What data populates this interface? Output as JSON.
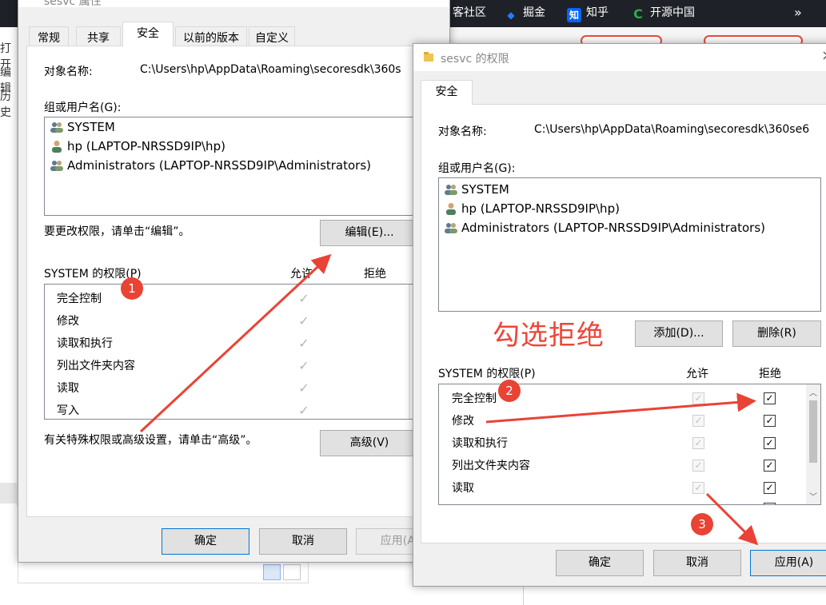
{
  "background": {
    "bookmarks": [
      {
        "label": "客社区",
        "icon": "",
        "color": "#1f2128"
      },
      {
        "label": "掘金",
        "icon": "juejin-icon",
        "color": "#1e80ff"
      },
      {
        "label": "知乎",
        "icon": "zhihu-icon",
        "glyph": "知",
        "color": "#0066ff"
      },
      {
        "label": "开源中国",
        "icon": "oschina-icon",
        "glyph": "C",
        "color": "#22b14c"
      }
    ],
    "more_glyph": "»",
    "left_texts": [
      "打开",
      "编辑",
      "历史"
    ]
  },
  "props_dialog": {
    "title": "sesvc 属性",
    "tabs": [
      "常规",
      "共享",
      "安全",
      "以前的版本",
      "自定义"
    ],
    "active_tab": "安全",
    "object_name_label": "对象名称:",
    "object_name_value": "C:\\Users\\hp\\AppData\\Roaming\\secoresdk\\360s",
    "group_label": "组或用户名(G):",
    "users": [
      {
        "name": "SYSTEM",
        "icon": "user-group-icon"
      },
      {
        "name": "hp (LAPTOP-NRSSD9IP\\hp)",
        "icon": "user-icon"
      },
      {
        "name": "Administrators (LAPTOP-NRSSD9IP\\Administrators)",
        "icon": "user-group-icon"
      }
    ],
    "edit_hint": "要更改权限，请单击“编辑”。",
    "edit_button": "编辑(E)...",
    "perm_label": "SYSTEM 的权限(P)",
    "allow_header": "允许",
    "deny_header": "拒绝",
    "permissions": [
      "完全控制",
      "修改",
      "读取和执行",
      "列出文件夹内容",
      "读取",
      "写入"
    ],
    "advanced_hint": "有关特殊权限或高级设置，请单击“高级”。",
    "advanced_button": "高级(V)",
    "ok_button": "确定",
    "cancel_button": "取消",
    "apply_button": "应用(A)"
  },
  "perm_dialog": {
    "title": "sesvc 的权限",
    "tab": "安全",
    "object_name_label": "对象名称:",
    "object_name_value": "C:\\Users\\hp\\AppData\\Roaming\\secoresdk\\360se6",
    "group_label": "组或用户名(G):",
    "users": [
      {
        "name": "SYSTEM",
        "icon": "user-group-icon"
      },
      {
        "name": "hp (LAPTOP-NRSSD9IP\\hp)",
        "icon": "user-icon"
      },
      {
        "name": "Administrators (LAPTOP-NRSSD9IP\\Administrators)",
        "icon": "user-group-icon"
      }
    ],
    "add_button": "添加(D)...",
    "remove_button": "删除(R)",
    "perm_label": "SYSTEM 的权限(P)",
    "allow_header": "允许",
    "deny_header": "拒绝",
    "permissions": [
      {
        "name": "完全控制",
        "allow": true,
        "deny": true
      },
      {
        "name": "修改",
        "allow": true,
        "deny": true
      },
      {
        "name": "读取和执行",
        "allow": true,
        "deny": true
      },
      {
        "name": "列出文件夹内容",
        "allow": true,
        "deny": true
      },
      {
        "name": "读取",
        "allow": true,
        "deny": true
      }
    ],
    "ok_button": "确定",
    "cancel_button": "取消",
    "apply_button": "应用(A)",
    "close_glyph": "×"
  },
  "annotations": {
    "step_labels": [
      "1",
      "2",
      "3"
    ],
    "callout_text": "勾选拒绝",
    "color": "#e94335"
  }
}
